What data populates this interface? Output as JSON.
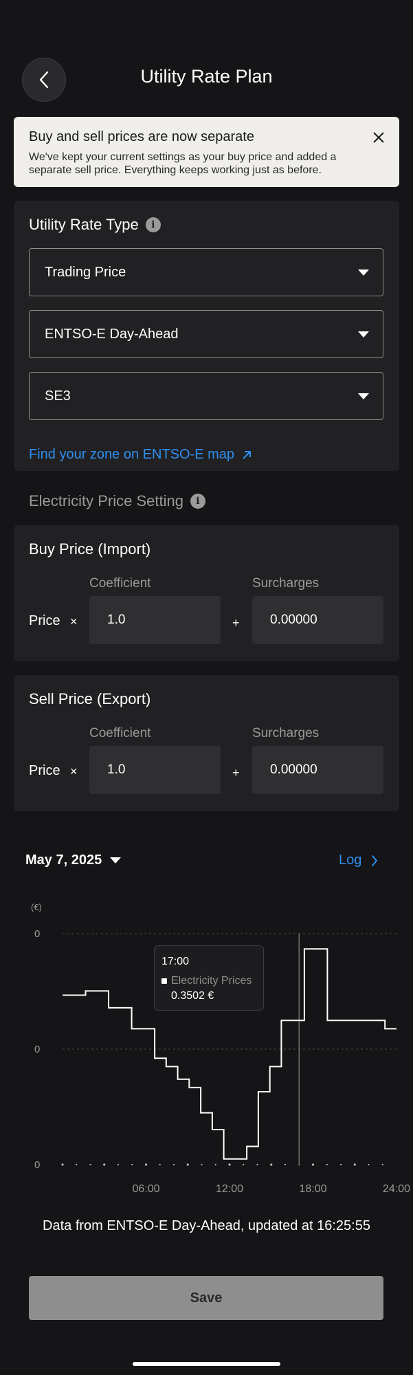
{
  "header": {
    "title": "Utility Rate Plan"
  },
  "banner": {
    "title": "Buy and sell prices are now separate",
    "text": "We've kept your current settings as your buy price and added a separate sell price. Everything keeps working just as before."
  },
  "rate_type": {
    "title": "Utility Rate Type",
    "selects": [
      {
        "value": "Trading Price"
      },
      {
        "value": "ENTSO-E Day-Ahead"
      },
      {
        "value": "SE3"
      }
    ],
    "link_text": "Find your zone on ENTSO-E map"
  },
  "price_setting": {
    "title": "Electricity Price Setting"
  },
  "buy": {
    "title": "Buy Price (Import)",
    "price_label": "Price",
    "times": "×",
    "plus": "+",
    "coefficient_label": "Coefficient",
    "coefficient_value": "1.0",
    "surcharges_label": "Surcharges",
    "surcharges_value": "0.00000"
  },
  "sell": {
    "title": "Sell Price (Export)",
    "price_label": "Price",
    "times": "×",
    "plus": "+",
    "coefficient_label": "Coefficient",
    "coefficient_value": "1.0",
    "surcharges_label": "Surcharges",
    "surcharges_value": "0.00000"
  },
  "chart_header": {
    "date": "May 7, 2025",
    "log_label": "Log"
  },
  "chart_data": {
    "type": "line",
    "step": true,
    "unit_label": "(€)",
    "y_tick_labels": [
      "0",
      "0",
      "0"
    ],
    "x_tick_labels": [
      "06:00",
      "12:00",
      "18:00",
      "24:00"
    ],
    "x": [
      "00:00",
      "01:00",
      "02:00",
      "03:00",
      "04:00",
      "05:00",
      "06:00",
      "07:00",
      "08:00",
      "09:00",
      "10:00",
      "11:00",
      "12:00",
      "13:00",
      "14:00",
      "15:00",
      "16:00",
      "17:00",
      "18:00",
      "19:00",
      "20:00",
      "21:00",
      "22:00",
      "23:00"
    ],
    "series": [
      {
        "name": "Electricity Prices",
        "values": [
          0.41,
          0.41,
          0.42,
          0.42,
          0.38,
          0.38,
          0.33,
          0.33,
          0.26,
          0.24,
          0.21,
          0.19,
          0.13,
          0.09,
          0.02,
          0.02,
          0.05,
          0.18,
          0.24,
          0.35,
          0.35,
          0.52,
          0.52,
          0.35,
          0.35,
          0.35,
          0.35,
          0.35,
          0.33
        ]
      }
    ],
    "tooltip": {
      "time": "17:00",
      "series": "Electricity Prices",
      "value": "0.3502 €"
    },
    "cursor_x": "17:00",
    "grid": "horizontal dashed",
    "caption": "Data from ENTSO-E Day-Ahead, updated at 16:25:55"
  },
  "footer": {
    "save_label": "Save"
  }
}
